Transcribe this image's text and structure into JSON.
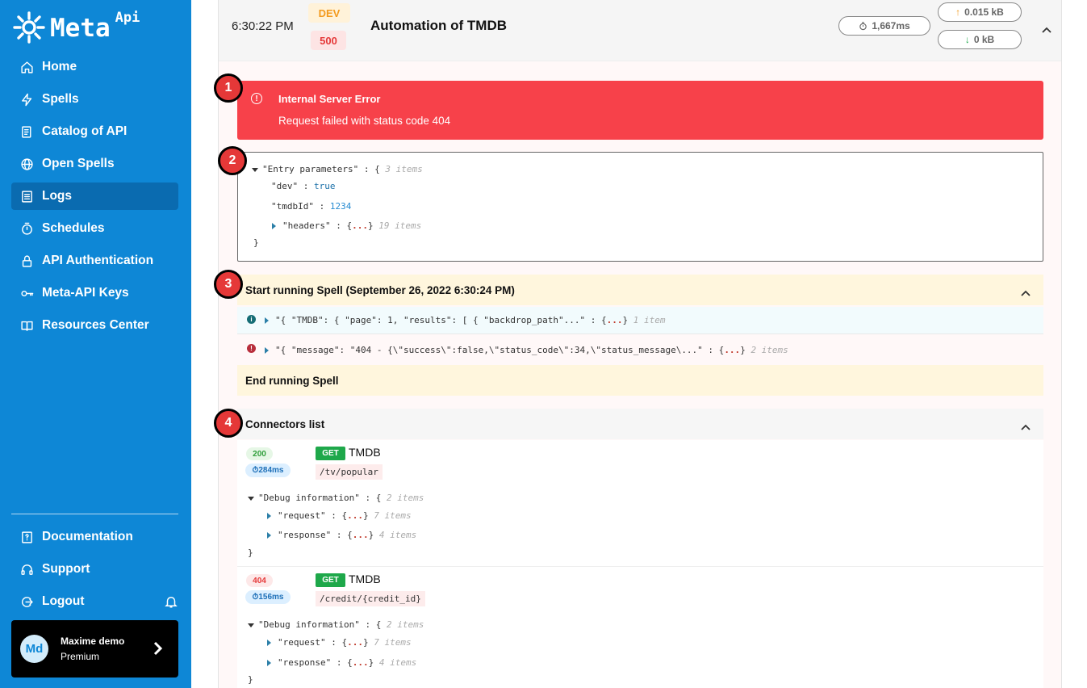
{
  "brand": {
    "name": "Meta",
    "suffix": "Api"
  },
  "nav": [
    {
      "label": "Home",
      "icon": "home-icon"
    },
    {
      "label": "Spells",
      "icon": "bolt-icon"
    },
    {
      "label": "Catalog of API",
      "icon": "catalog-icon"
    },
    {
      "label": "Open Spells",
      "icon": "globe-icon"
    },
    {
      "label": "Logs",
      "icon": "logs-icon",
      "active": true
    },
    {
      "label": "Schedules",
      "icon": "timer-icon"
    },
    {
      "label": "API Authentication",
      "icon": "lock-icon"
    },
    {
      "label": "Meta-API Keys",
      "icon": "key-icon"
    },
    {
      "label": "Resources Center",
      "icon": "book-icon"
    }
  ],
  "bottom_nav": [
    {
      "label": "Documentation",
      "icon": "doc-icon"
    },
    {
      "label": "Support",
      "icon": "headset-icon"
    },
    {
      "label": "Logout",
      "icon": "logout-icon"
    }
  ],
  "user": {
    "initials": "Md",
    "name": "Maxime demo",
    "plan": "Premium"
  },
  "log": {
    "time": "6:30:22 PM",
    "env": "DEV",
    "status": "500",
    "title": "Automation of TMDB",
    "duration": "1,667ms",
    "upload": "0.015 kB",
    "download": "0 kB"
  },
  "markers": [
    "1",
    "2",
    "3",
    "4"
  ],
  "error": {
    "title": "Internal Server Error",
    "message": "Request failed with status code 404"
  },
  "entry": {
    "root_key": "\"Entry parameters\"",
    "root_count": "3 items",
    "dev_key": "\"dev\"",
    "dev_val": "true",
    "tmdb_key": "\"tmdbId\"",
    "tmdb_val": "1234",
    "headers_key": "\"headers\"",
    "headers_count": "19 items"
  },
  "spell": {
    "start": "Start running Spell (September 26, 2022 6:30:24 PM)",
    "info_line": "\"{ \"TMDB\": { \"page\": 1, \"results\": [ { \"backdrop_path\"...\"",
    "info_count": "1 item",
    "err_line": "\"{ \"message\": \"404 - {\\\"success\\\":false,\\\"status_code\\\":34,\\\"status_message\\...\"",
    "err_count": "2 items",
    "end": "End running Spell"
  },
  "connectors": {
    "title": "Connectors list",
    "items": [
      {
        "status": "200",
        "duration": "284ms",
        "method": "GET",
        "name": "TMDB",
        "path": "/tv/popular",
        "debug_key": "\"Debug information\"",
        "debug_count": "2 items",
        "req_key": "\"request\"",
        "req_count": "7 items",
        "res_key": "\"response\"",
        "res_count": "4 items"
      },
      {
        "status": "404",
        "duration": "156ms",
        "method": "GET",
        "name": "TMDB",
        "path": "/credit/{credit_id}",
        "debug_key": "\"Debug information\"",
        "debug_count": "2 items",
        "req_key": "\"request\"",
        "req_count": "7 items",
        "res_key": "\"response\"",
        "res_count": "4 items"
      }
    ]
  },
  "colors": {
    "sidebar": "#0e87d6",
    "active": "#0a6bb0",
    "error": "#f7414a",
    "success": "#1ea84a"
  }
}
